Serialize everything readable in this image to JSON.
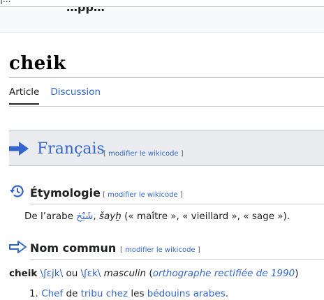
{
  "header": {
    "top_cut_text": "|...",
    "top_cut_text_2": "…pp…"
  },
  "page": {
    "title": "cheik"
  },
  "tabs": [
    {
      "label": "Article"
    },
    {
      "label": "Discussion"
    }
  ],
  "language_section": {
    "name": "Français",
    "edit_open": "[ ",
    "edit_label": "modifier le wikicode",
    "edit_close": " ]"
  },
  "etymology": {
    "title": "Étymologie",
    "edit_label": "modifier le wikicode",
    "intro": "De l’arabe ",
    "arabic": "شَيْخ",
    "comma": ", ",
    "translit": "šayḫ",
    "gloss": " (« maître », « vieillard », « sage »)."
  },
  "pos_section": {
    "title": "Nom commun",
    "edit_label": "modifier le wikicode",
    "headword": "cheik",
    "ipa1": "\\ʃɛjk\\",
    "or": " ou ",
    "ipa2": "\\ʃɛk\\",
    "gender": "masculin",
    "paren_open": " (",
    "ortho_note": "orthographe rectifiée de 1990",
    "paren_close": ")"
  },
  "definitions": [
    {
      "number": "1.",
      "w1": "Chef",
      "w2": " de ",
      "w3": "tribu",
      "w4": " ",
      "w5": "chez",
      "w6": " les ",
      "w7": "bédouins",
      "w8": " ",
      "w9": "arabes",
      "w10": "."
    }
  ],
  "colors": {
    "link": "#3366cc",
    "text": "#202122",
    "lang_box_bg": "#eaecf0"
  },
  "icons": {
    "language": "right-arrow-icon",
    "etymology": "history-icon",
    "pos": "outline-right-arrow-icon"
  }
}
